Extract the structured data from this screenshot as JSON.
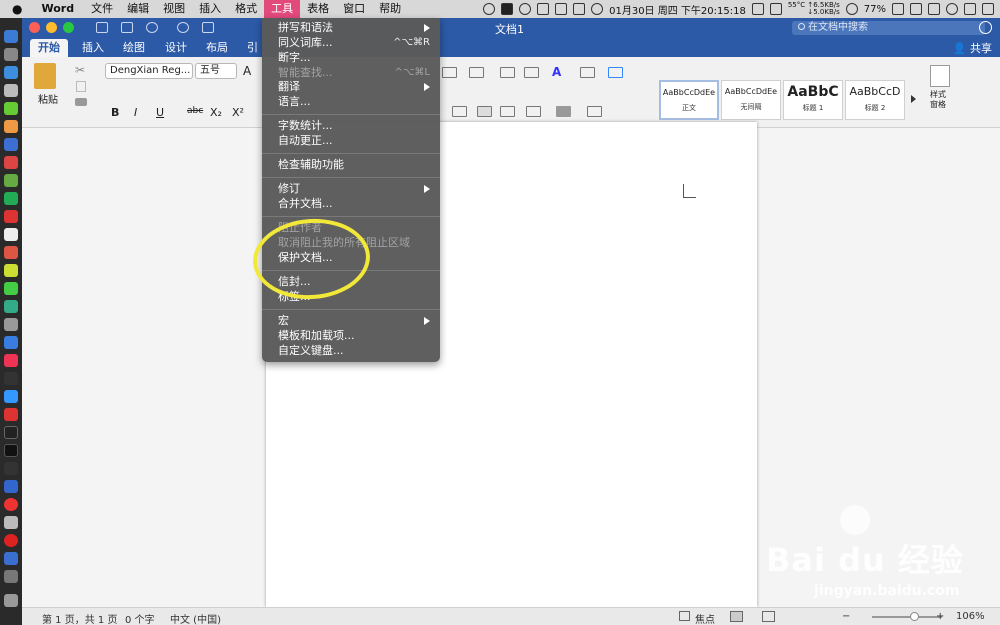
{
  "menubar": {
    "apple_icon": "apple-logo-icon",
    "app_name": "Word",
    "items": [
      "文件",
      "编辑",
      "视图",
      "插入",
      "格式",
      "工具",
      "表格",
      "窗口",
      "帮助"
    ],
    "active_item": "工具",
    "status": {
      "temp": "55°C",
      "net_up": "↑6.5KB/s",
      "net_down": "↓5.0KB/s",
      "clock": "01月30日 周四 下午20:15:18",
      "battery": "77%"
    }
  },
  "window": {
    "title": "文档1",
    "search_placeholder": "在文档中搜索",
    "tabs": [
      "开始",
      "插入",
      "绘图",
      "设计",
      "布局",
      "引"
    ],
    "active_tab": "开始",
    "share_label": "共享"
  },
  "ribbon": {
    "paste_label": "粘贴",
    "font_name": "DengXian Reg...",
    "font_size": "五号",
    "font_grow": "A",
    "format_buttons": [
      "B",
      "I",
      "U",
      "abc",
      "X₂",
      "X²"
    ],
    "styles": [
      {
        "sample": "AaBbCcDdEe",
        "name": "正文"
      },
      {
        "sample": "AaBbCcDdEe",
        "name": "无间隔"
      },
      {
        "sample": "AaBbC",
        "name": "标题 1"
      },
      {
        "sample": "AaBbCcD",
        "name": "标题 2"
      }
    ],
    "styles_pane_label": "样式\n窗格"
  },
  "tools_menu": {
    "groups": [
      [
        {
          "label": "拼写和语法",
          "submenu": true,
          "disabled": false
        },
        {
          "label": "同义词库...",
          "shortcut": "^⌥⌘R",
          "disabled": false
        },
        {
          "label": "断字...",
          "disabled": false
        },
        {
          "label": "智能查找...",
          "shortcut": "^⌥⌘L",
          "disabled": true
        },
        {
          "label": "翻译",
          "submenu": true,
          "disabled": false
        },
        {
          "label": "语言...",
          "disabled": false
        }
      ],
      [
        {
          "label": "字数统计...",
          "disabled": false
        },
        {
          "label": "自动更正...",
          "disabled": false
        }
      ],
      [
        {
          "label": "检查辅助功能",
          "disabled": false
        }
      ],
      [
        {
          "label": "修订",
          "submenu": true,
          "disabled": false
        },
        {
          "label": "合并文档...",
          "disabled": false
        }
      ],
      [
        {
          "label": "阻止作者",
          "disabled": true
        },
        {
          "label": "取消阻止我的所有阻止区域",
          "disabled": true
        },
        {
          "label": "保护文档...",
          "disabled": false
        }
      ],
      [
        {
          "label": "信封...",
          "disabled": false
        },
        {
          "label": "标签...",
          "disabled": false
        }
      ],
      [
        {
          "label": "宏",
          "submenu": true,
          "disabled": false
        },
        {
          "label": "模板和加载项...",
          "disabled": false
        },
        {
          "label": "自定义键盘...",
          "disabled": false
        }
      ]
    ]
  },
  "statusbar": {
    "page": "第 1 页，共 1 页",
    "words": "0 个字",
    "language": "中文 (中国)",
    "focus_label": "焦点",
    "zoom": "106%"
  },
  "watermark": {
    "logo": "Bai du 经验",
    "url": "jingyan.baidu.com"
  },
  "colors": {
    "title_blue": "#2c5aa7",
    "menu_active": "#e24a7c",
    "highlight_yellow": "#f1e83a"
  }
}
